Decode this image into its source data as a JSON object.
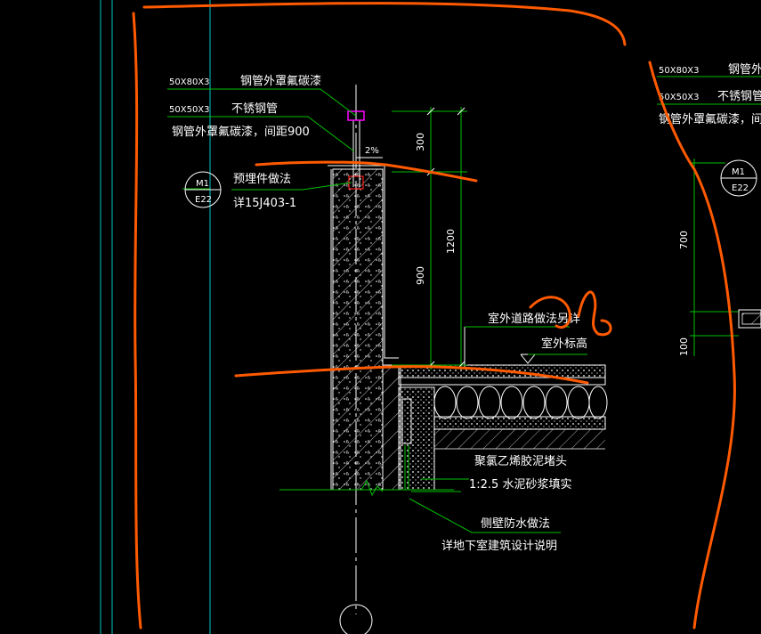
{
  "labels": {
    "rail_spec_top": "50X80X3",
    "rail_coating_1": "钢管外罩氟碳漆",
    "post_spec": "50X50X3",
    "post_material": "不锈钢管",
    "post_coating_spacing": "钢管外罩氟碳漆，间距900",
    "slope": "2%",
    "embed_item": "预埋件做法",
    "embed_ref": "详15J403-1",
    "callout_num": "M1",
    "callout_sheet": "E22",
    "outdoor_road": "室外道路做法另详",
    "outdoor_grade": "室外标高",
    "pvc_plug": "聚氯乙烯胶泥堵头",
    "mortar_fill": "1:2.5   水泥砂浆填实",
    "side_waterproof": "侧壁防水做法",
    "basement_ref": "详地下室建筑设计说明",
    "right_rail_spec": "50X80X3",
    "right_rail_coating": "钢管外罩",
    "right_post_spec": "50X50X3",
    "right_post_material": "不锈钢管",
    "right_coating_spacing": "钢管外罩氟碳漆，间距",
    "right_callout_num": "M1",
    "right_callout_sheet": "E22"
  },
  "dimensions": {
    "d300": "300",
    "d1200": "1200",
    "d900": "900",
    "d700": "700",
    "d100": "100"
  },
  "colors": {
    "background": "#000000",
    "line_white": "#ffffff",
    "line_green": "#00c000",
    "grid_cyan": "#00c8c8",
    "markup_orange": "#ff5a00",
    "post_magenta": "#ff00ff",
    "embed_red": "#ff2020"
  }
}
